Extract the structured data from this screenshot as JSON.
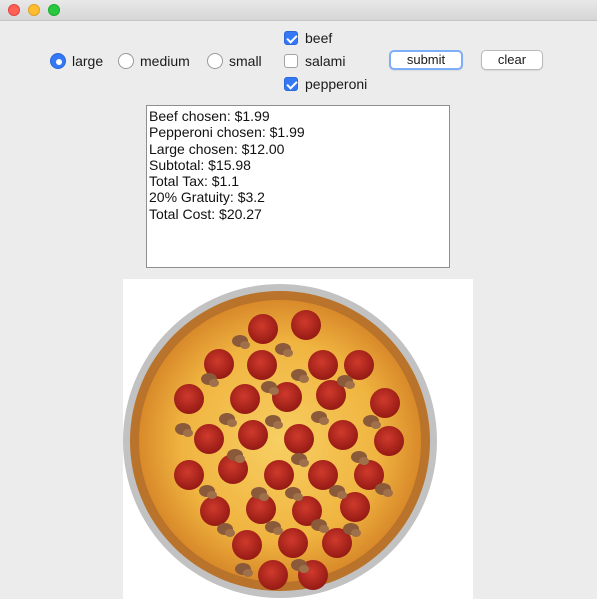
{
  "window": {
    "controls": [
      "close",
      "minimize",
      "maximize"
    ]
  },
  "size_options": [
    {
      "label": "large",
      "selected": true
    },
    {
      "label": "medium",
      "selected": false
    },
    {
      "label": "small",
      "selected": false
    }
  ],
  "toppings": [
    {
      "label": "beef",
      "checked": true
    },
    {
      "label": "salami",
      "checked": false
    },
    {
      "label": "pepperoni",
      "checked": true
    }
  ],
  "buttons": {
    "submit_label": "submit",
    "clear_label": "clear"
  },
  "receipt": {
    "lines": [
      "Beef chosen: $1.99",
      "Pepperoni chosen: $1.99",
      "Large chosen: $12.00",
      "Subtotal: $15.98",
      "Total Tax: $1.1",
      "20% Gratuity: $3.2",
      "Total Cost: $20.27"
    ]
  },
  "pizza_image": {
    "icon": "pizza-pepperoni-beef-image",
    "colors": {
      "crust": "#c9822e",
      "cheese": "#f2b84a",
      "pepperoni": "#b5211a",
      "beef": "#8a5a3a",
      "pan": "#b8b8b8"
    }
  }
}
